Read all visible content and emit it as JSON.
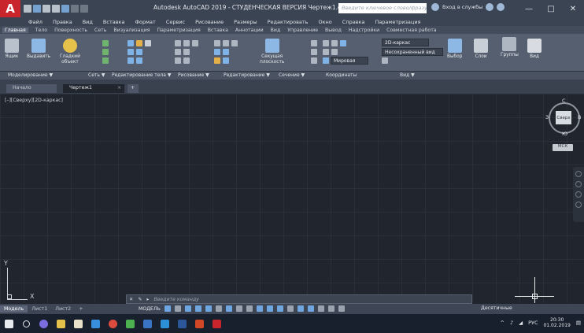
{
  "app": {
    "logo": "A",
    "title": "Autodesk AutoCAD 2019 - СТУДЕНЧЕСКАЯ ВЕРСИЯ    Чертеж1.dwg",
    "search_placeholder": "Введите ключевое слово/фразу",
    "signin": "Вход в службы",
    "window_controls": [
      "—",
      "□",
      "✕"
    ]
  },
  "menubar": [
    "Файл",
    "Правка",
    "Вид",
    "Вставка",
    "Формат",
    "Сервис",
    "Рисование",
    "Размеры",
    "Редактировать",
    "Окно",
    "Справка",
    "Параметризация"
  ],
  "ribbon_tabs": [
    "Главная",
    "Тело",
    "Поверхность",
    "Сеть",
    "Визуализация",
    "Параметризация",
    "Вставка",
    "Аннотации",
    "Вид",
    "Управление",
    "Вывод",
    "Надстройки",
    "Совместная работа"
  ],
  "ribbon": {
    "yashchik": "Ящик",
    "vydavit": "Выдавить",
    "gladkiy_obekt": "Гладкий\nобъект",
    "sekushchaya": "Секущая\nплоскость",
    "visual_style": "2D-каркас",
    "unsaved_view": "Несохраненный вид",
    "world": "Мировая",
    "vybor": "Выбор",
    "sloi": "Слои",
    "gruppy": "Группы",
    "vid": "Вид"
  },
  "panel_labels": [
    "Моделирование ▼",
    "Сеть ▼",
    "Редактирование тела ▼",
    "Рисование ▼",
    "Редактирование ▼",
    "Сечение ▼",
    "Координаты",
    "Вид ▼"
  ],
  "doc_tabs": {
    "start": "Начало",
    "drawing": "Чертеж1",
    "close": "×",
    "new": "+"
  },
  "viewport": {
    "label": "[–][Сверху][2D-каркас]",
    "viewcube": {
      "n": "С",
      "s": "Ю",
      "e": "В",
      "w": "З",
      "face": "Сверх"
    },
    "wcs": "МСК",
    "ucs_y": "Y",
    "ucs_x": "X"
  },
  "command": {
    "placeholder": "Введите команду"
  },
  "layout_tabs": [
    "Модель",
    "Лист1",
    "Лист2"
  ],
  "status": {
    "model": "МОДЕЛЬ",
    "units": "Десятичные"
  },
  "taskbar": {
    "lang": "РУС",
    "time": "20:30",
    "date": "01.02.2019"
  }
}
